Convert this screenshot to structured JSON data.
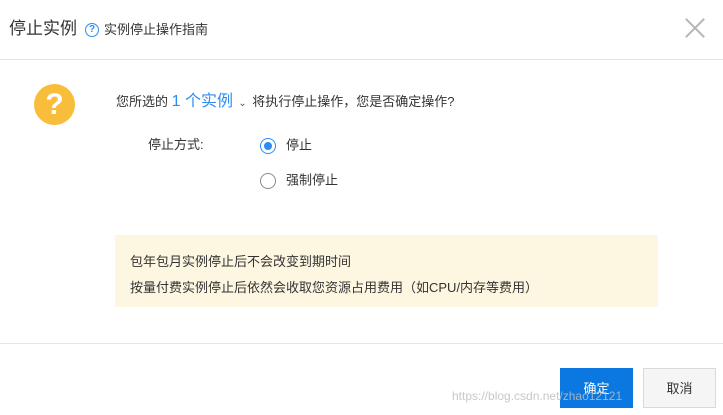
{
  "header": {
    "title": "停止实例",
    "help_glyph": "?",
    "help_link": "实例停止操作指南",
    "close_glyph": ""
  },
  "main": {
    "warn_glyph": "?",
    "question_prefix": "您所选的",
    "selected_count_label": "1 个实例",
    "question_suffix": "将执行停止操作，您是否确定操作?",
    "mode_label": "停止方式:",
    "options": [
      {
        "label": "停止",
        "checked": true
      },
      {
        "label": "强制停止",
        "checked": false
      }
    ],
    "notice_lines": [
      "包年包月实例停止后不会改变到期时间",
      "按量付费实例停止后依然会收取您资源占用费用（如CPU/内存等费用）"
    ]
  },
  "footer": {
    "ok_label": "确定",
    "cancel_label": "取消",
    "watermark": "https://blog.csdn.net/zhao12121"
  },
  "colors": {
    "accent": "#2d8cf0",
    "primary_button": "#0b77e1",
    "warning_icon": "#f8be3b",
    "notice_bg": "#fdf6e1"
  },
  "icons": [
    "help-icon",
    "close-icon",
    "question-mark-icon",
    "chevron-down-icon"
  ]
}
